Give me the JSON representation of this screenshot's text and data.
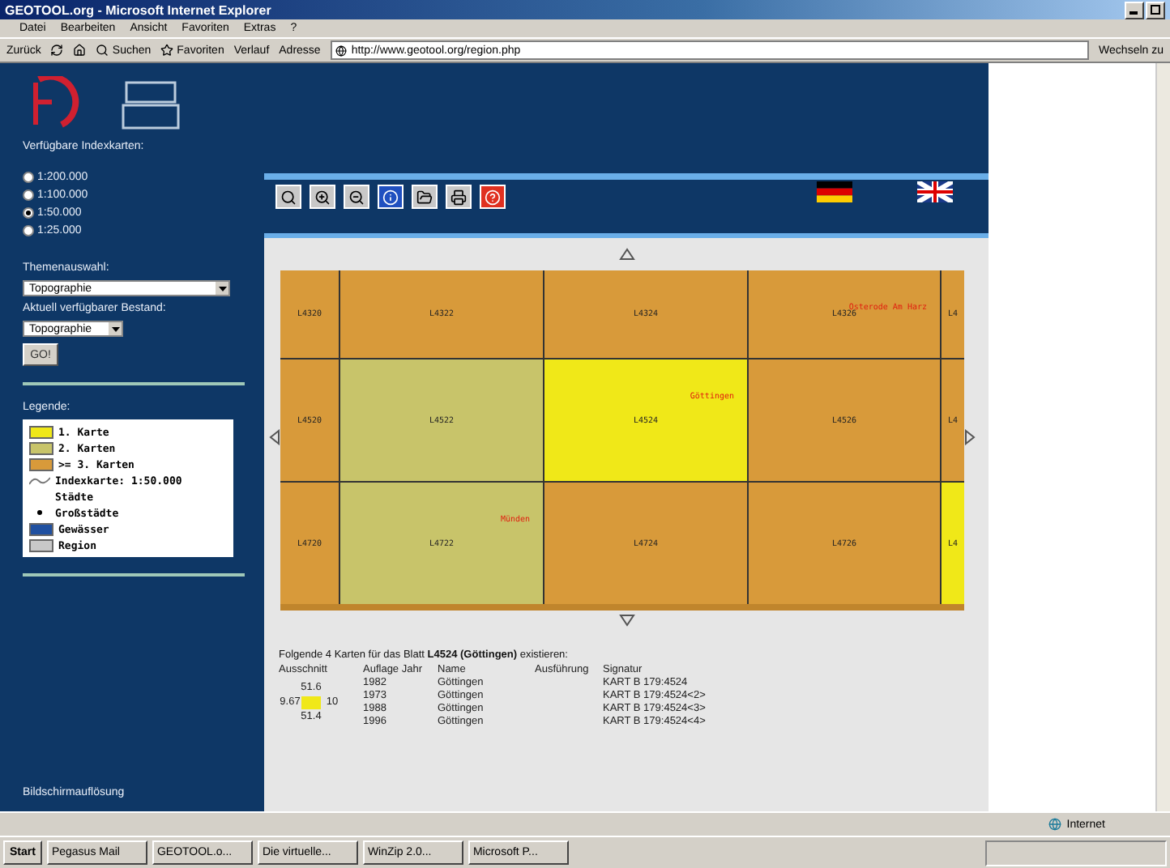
{
  "window": {
    "title": "GEOTOOL.org - Microsoft Internet Explorer"
  },
  "menu": [
    "Datei",
    "Bearbeiten",
    "Ansicht",
    "Favoriten",
    "Extras",
    "?"
  ],
  "toolbar": {
    "back": "Zurück",
    "search": "Suchen",
    "favorites": "Favoriten",
    "history": "Verlauf",
    "address_label": "Adresse",
    "url": "http://www.geotool.org/region.php",
    "go": "Wechseln zu"
  },
  "sidebar": {
    "index_title": "Verfügbare Indexkarten:",
    "scales": [
      {
        "label": "1:200.000",
        "selected": false
      },
      {
        "label": "1:100.000",
        "selected": false
      },
      {
        "label": "1:50.000",
        "selected": true
      },
      {
        "label": "1:25.000",
        "selected": false
      }
    ],
    "theme_label": "Themenauswahl:",
    "theme_value": "Topographie",
    "stock_label": "Aktuell verfügbarer Bestand:",
    "stock_value": "Topographie",
    "go_button": "GO!",
    "legend_title": "Legende:",
    "legend": [
      {
        "kind": "swatch",
        "color": "#f0e818",
        "label": "1. Karte"
      },
      {
        "kind": "swatch",
        "color": "#c8c46a",
        "label": "2. Karten"
      },
      {
        "kind": "swatch",
        "color": "#d89a3a",
        "label": ">= 3. Karten"
      },
      {
        "kind": "line",
        "label": "Indexkarte: 1:50.000"
      },
      {
        "kind": "text",
        "label": "Städte"
      },
      {
        "kind": "dot",
        "label": "Großstädte"
      },
      {
        "kind": "swatch",
        "color": "#2050a0",
        "label": "Gewässer"
      },
      {
        "kind": "swatch",
        "color": "#c8c8c8",
        "label": "Region"
      }
    ],
    "resolution_label": "Bildschirmauflösung"
  },
  "map": {
    "tiles": [
      [
        {
          "label": "L4320",
          "color": "#d89a3a"
        },
        {
          "label": "L4322",
          "color": "#d89a3a"
        },
        {
          "label": "L4324",
          "color": "#d89a3a"
        },
        {
          "label": "L4326",
          "color": "#d89a3a",
          "city": "Osterode Am Harz"
        },
        {
          "label": "L4",
          "color": "#d89a3a"
        }
      ],
      [
        {
          "label": "L4520",
          "color": "#d89a3a"
        },
        {
          "label": "L4522",
          "color": "#c8c46a"
        },
        {
          "label": "L4524",
          "color": "#f0e818",
          "city": "Göttingen"
        },
        {
          "label": "L4526",
          "color": "#d89a3a"
        },
        {
          "label": "L4",
          "color": "#d89a3a"
        }
      ],
      [
        {
          "label": "L4720",
          "color": "#d89a3a"
        },
        {
          "label": "L4722",
          "color": "#c8c46a",
          "city": "Münden"
        },
        {
          "label": "L4724",
          "color": "#d89a3a"
        },
        {
          "label": "L4726",
          "color": "#d89a3a"
        },
        {
          "label": "L4",
          "color": "#f0e818"
        }
      ]
    ]
  },
  "result": {
    "intro": "Folgende 4 Karten für das Blatt **L4524 (Göttingen)** existieren:",
    "columns": [
      "Ausschnitt",
      "Auflage Jahr",
      "Name",
      "Ausführung",
      "Signatur"
    ],
    "extent": {
      "north": "51.6",
      "west": "9.67",
      "east": "10",
      "south": "51.4"
    },
    "rows": [
      {
        "year": "1982",
        "name": "Göttingen",
        "signature": "KART B 179:4524"
      },
      {
        "year": "1973",
        "name": "Göttingen",
        "signature": "KART B 179:4524<2>"
      },
      {
        "year": "1988",
        "name": "Göttingen",
        "signature": "KART B 179:4524<3>"
      },
      {
        "year": "1996",
        "name": "Göttingen",
        "signature": "KART B 179:4524<4>"
      }
    ]
  },
  "status_bar": {
    "zone": "Internet"
  },
  "taskbar": {
    "start": "Start",
    "tasks": [
      "Pegasus Mail",
      "GEOTOOL.o...",
      "Die virtuelle...",
      "WinZip 2.0...",
      "Microsoft P..."
    ]
  }
}
